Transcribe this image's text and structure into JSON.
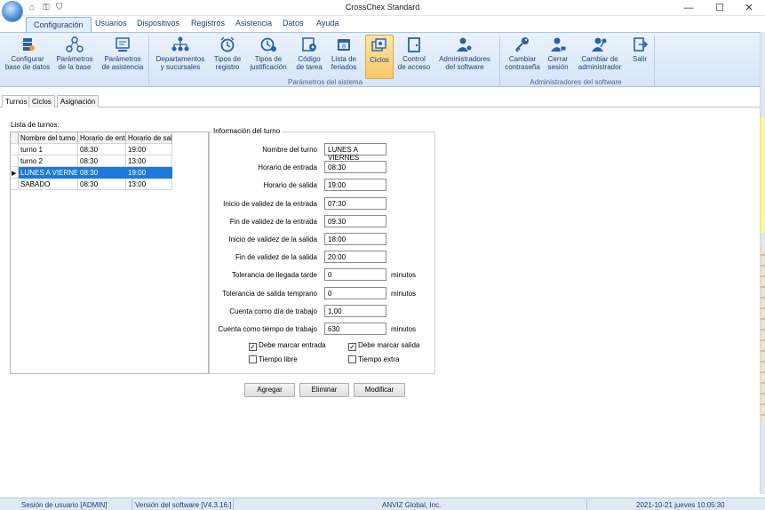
{
  "window": {
    "title": "CrossChex Standard",
    "minimize": "—",
    "maximize": "☐",
    "close": "✕"
  },
  "quick_access": [
    "⌂",
    "⚿",
    "⛉"
  ],
  "ribbon_tabs": [
    "Configuración",
    "Usuarios",
    "Dispositivos",
    "Registros",
    "Asistencia",
    "Datos",
    "Ayuda"
  ],
  "ribbon": {
    "groups": {
      "sistema": "Parámetros del sistema",
      "software": "Administradores del software"
    },
    "buttons": {
      "configurar": [
        "Configurar",
        "base de datos"
      ],
      "parametros_base": [
        "Parámetros",
        "de la base"
      ],
      "parametros_asistencia": [
        "Parámetros",
        "de asistencia"
      ],
      "departamentos": [
        "Departamentos",
        "y sucursales"
      ],
      "tipos_registro": [
        "Tipos de",
        "registro"
      ],
      "tipos_justificacion": [
        "Tipos de",
        "justificación"
      ],
      "codigo_tarea": [
        "Código",
        "de tarea"
      ],
      "lista_feriados": [
        "Lista de",
        "feriados"
      ],
      "ciclos": [
        "Ciclos",
        ""
      ],
      "control_acceso": [
        "Control",
        "de acceso"
      ],
      "administradores": [
        "Administradores",
        "del software"
      ],
      "cambiar_contrasena": [
        "Cambiar",
        "contraseña"
      ],
      "cerrar_sesion": [
        "Cerrar",
        "sesión"
      ],
      "cambiar_admin": [
        "Cambiar de",
        "administrador"
      ],
      "salir": [
        "Salir",
        ""
      ]
    }
  },
  "inner_tabs": [
    "Turnos",
    "Ciclos",
    "Asignación"
  ],
  "shifts": {
    "list_label": "Lista de turnos:",
    "columns": [
      "Nombre del turno",
      "Horario de entrada",
      "Horario de salida"
    ],
    "rows": [
      [
        "turno 1",
        "08:30",
        "19:00"
      ],
      [
        "turno 2",
        "08:30",
        "13:00"
      ],
      [
        "LUNES A VIERNES",
        "08:30",
        "19:00"
      ],
      [
        "SABADO",
        "08:30",
        "13:00"
      ]
    ],
    "selected_indicator": "▶"
  },
  "info": {
    "title": "Información del turno",
    "fields": [
      {
        "label": "Nombre del turno",
        "value": "LUNES A VIERNES",
        "unit": ""
      },
      {
        "label": "Horario de entrada",
        "value": "08:30",
        "unit": ""
      },
      {
        "label": "Horario de salida",
        "value": "19:00",
        "unit": ""
      },
      {
        "label": "Inicio de validez de la entrada",
        "value": "07:30",
        "unit": ""
      },
      {
        "label": "Fin de validez de la entrada",
        "value": "09:30",
        "unit": ""
      },
      {
        "label": "Inicio de validez de la salida",
        "value": "18:00",
        "unit": ""
      },
      {
        "label": "Fin de validez de la salida",
        "value": "20:00",
        "unit": ""
      },
      {
        "label": "Tolerancia de llegada tarde",
        "value": "0",
        "unit": "minutos"
      },
      {
        "label": "Tolerancia de salida temprano",
        "value": "0",
        "unit": "minutos"
      },
      {
        "label": "Cuenta como día de trabajo",
        "value": "1,00",
        "unit": ""
      },
      {
        "label": "Cuenta como tiempo de trabajo",
        "value": "630",
        "unit": "minutos"
      }
    ],
    "checkboxes": {
      "marcar_entrada": {
        "label": "Debe marcar entrada",
        "checked": true,
        "mark": "✓"
      },
      "marcar_salida": {
        "label": "Debe marcar salida",
        "checked": true,
        "mark": "✓"
      },
      "tiempo_libre": {
        "label": "Tiempo libre",
        "checked": false,
        "mark": ""
      },
      "tiempo_extra": {
        "label": "Tiempo extra",
        "checked": false,
        "mark": ""
      }
    }
  },
  "actions": {
    "agregar": "Agregar",
    "eliminar": "Eliminar",
    "modificar": "Modificar"
  },
  "status": {
    "session": "Sesión de usuario  [ADMIN]",
    "version": "Versión del software  [V4.3.16.]",
    "company": "ANVIZ Global, Inc.",
    "datetime": "2021-10-21 jueves 10:05:30"
  },
  "colors": {
    "accent": "#1c79d9",
    "ribbon_text": "#1e3f73",
    "active_button": "#f7c86a"
  }
}
